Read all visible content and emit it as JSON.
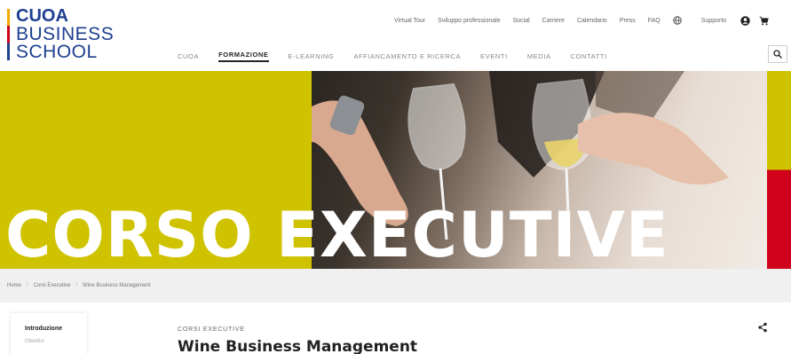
{
  "logo": {
    "line1": "CUOA",
    "line2": "BUSINESS",
    "line3": "SCHOOL"
  },
  "top_nav": {
    "items": [
      "Virtual Tour",
      "Sviluppo professionale",
      "Social",
      "Carriere",
      "Calendario",
      "Press",
      "FAQ"
    ],
    "support": "Supporto"
  },
  "main_nav": {
    "items": [
      "CUOA",
      "FORMAZIONE",
      "E-LEARNING",
      "AFFIANCAMENTO E RICERCA",
      "EVENTI",
      "MEDIA",
      "CONTATTI"
    ],
    "active": "FORMAZIONE"
  },
  "hero": {
    "title": "CORSO EXECUTIVE"
  },
  "breadcrumb": [
    "Home",
    "Corsi Executive",
    "Wine Business Management"
  ],
  "sidebar": {
    "items": [
      "Introduzione",
      "Obiettivi"
    ]
  },
  "content": {
    "kicker": "CORSI EXECUTIVE",
    "title": "Wine Business Management"
  },
  "colors": {
    "brand_blue": "#1d3f8f",
    "hero_yellow": "#cfc300",
    "accent_red": "#d0021b"
  },
  "icons": [
    "globe-icon",
    "user-icon",
    "cart-icon",
    "search-icon",
    "share-icon"
  ]
}
